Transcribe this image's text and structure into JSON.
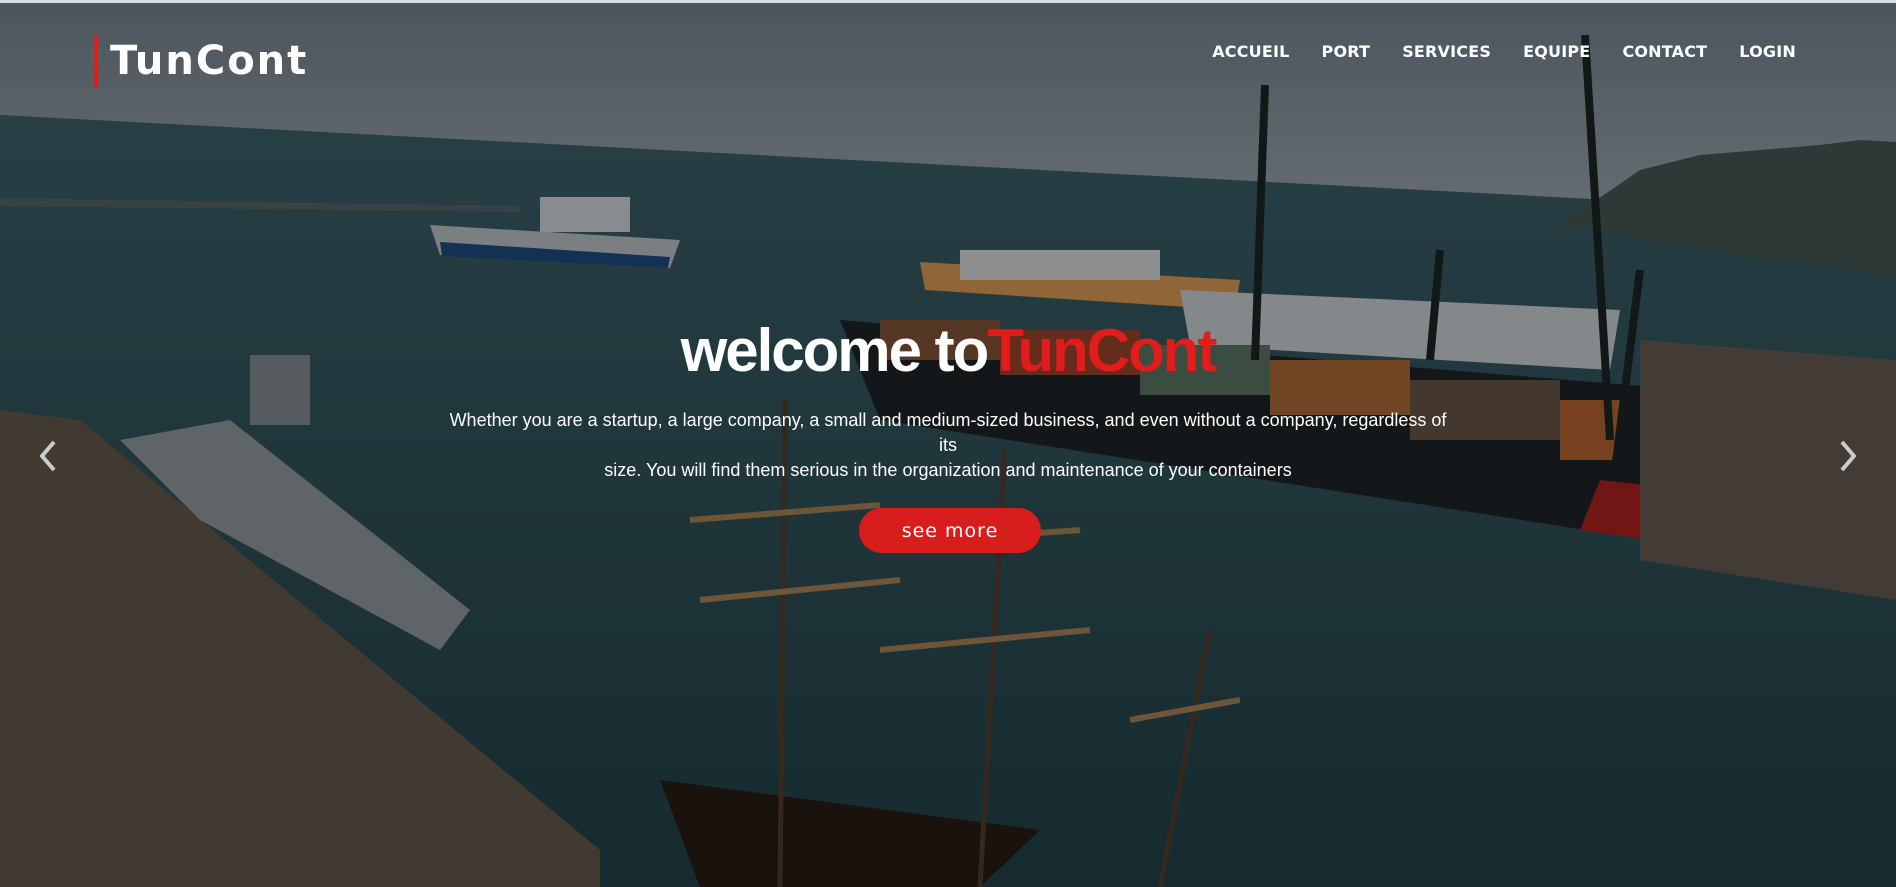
{
  "header": {
    "logo": "TunCont",
    "nav": [
      "ACCUEIL",
      "PORT",
      "SERVICES",
      "EQUIPE",
      "CONTACT",
      "LOGIN"
    ]
  },
  "hero": {
    "headline_prefix": "welcome to",
    "headline_brand": "TunCont",
    "subtitle_line1": "Whether you are a startup, a large company, a small and medium-sized business, and even without a company, regardless of its",
    "subtitle_line2": "size. You will find them serious in the organization and maintenance of your containers",
    "cta_label": "see more"
  },
  "icons": {
    "prev": "chevron-left-icon",
    "next": "chevron-right-icon"
  },
  "colors": {
    "accent": "#e21b1b",
    "text": "#ffffff",
    "button": "#d81d1d"
  }
}
